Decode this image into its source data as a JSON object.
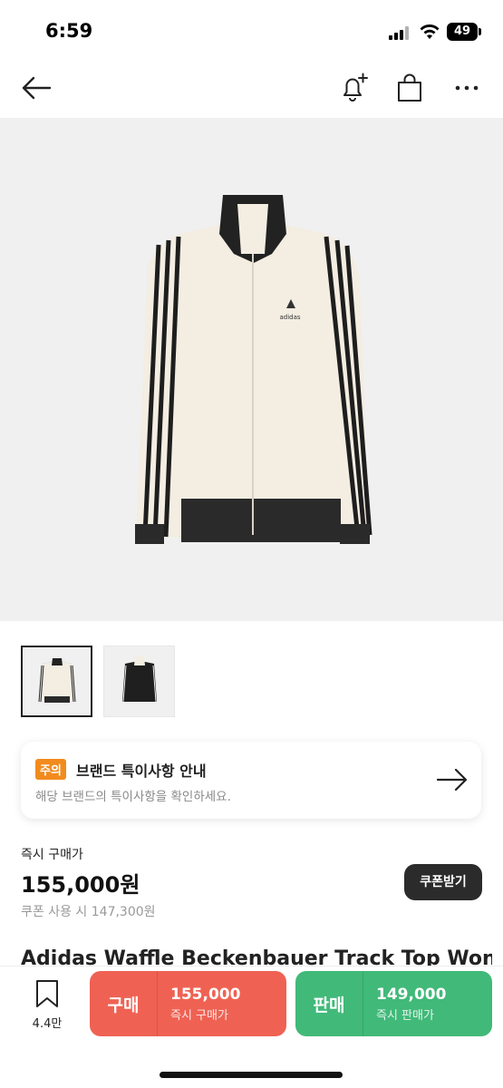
{
  "status_bar": {
    "time": "6:59",
    "battery": "49"
  },
  "notice": {
    "badge": "주의",
    "title": "브랜드 특이사항 안내",
    "description": "해당 브랜드의 특이사항을 확인하세요."
  },
  "price": {
    "label": "즉시 구매가",
    "value": "155,000원",
    "coupon_text": "쿠폰 사용 시 147,300원",
    "coupon_button": "쿠폰받기"
  },
  "product": {
    "name": "Adidas Waffle Beckenbauer Track Top Wonder"
  },
  "bottom_bar": {
    "wish_count": "4.4만",
    "buy": {
      "label": "구매",
      "price": "155,000",
      "sub": "즉시 구매가"
    },
    "sell": {
      "label": "판매",
      "price": "149,000",
      "sub": "즉시 판매가"
    }
  },
  "colors": {
    "buy": "#ef6253",
    "sell": "#41b979",
    "notice_badge": "#f28b1e"
  },
  "icons": [
    "back-arrow-icon",
    "bell-plus-icon",
    "shopping-bag-icon",
    "more-icon",
    "arrow-right-icon",
    "bookmark-icon"
  ]
}
